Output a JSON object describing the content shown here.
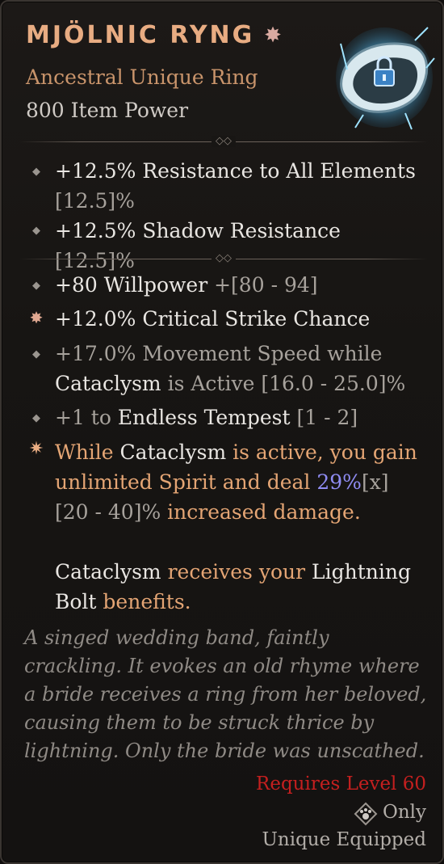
{
  "item": {
    "name": "MJÖLNIC RYNG",
    "name_icon": "sparkle-icon",
    "rarity_line": "Ancestral Unique Ring",
    "item_power": "800 Item Power",
    "image": "lightning-ring-image",
    "lock_icon": "padlock-icon"
  },
  "implicits": [
    {
      "text": "+12.5% Resistance to All Elements",
      "range": "[12.5]%"
    },
    {
      "text": "+12.5% Shadow Resistance",
      "range": "[12.5]%"
    }
  ],
  "affixes": {
    "willpower": {
      "text": "+80 Willpower",
      "range": "+[80 - 94]"
    },
    "crit": {
      "text": "+12.0% Critical Strike Chance"
    },
    "movement": {
      "part1": "+17.0% Movement Speed while",
      "skill": "Cataclysm",
      "part2": " is Active",
      "range": " [16.0 - 25.0]%"
    },
    "tempest": {
      "prefix": "+1 to ",
      "skill": "Endless Tempest",
      "range": " [1 - 2]"
    }
  },
  "unique_power": {
    "p1": "While ",
    "s1": "Cataclysm",
    "p2": " is active, you gain unlimited Spirit and deal ",
    "value": "29%",
    "mult": "[x]",
    "range": " [20 - 40]%",
    "p3": " increased damage.",
    "s2": "Cataclysm",
    "p4": " receives your ",
    "s3": "Lightning Bolt",
    "p5": " benefits."
  },
  "flavor": "A singed wedding band, faintly crackling. It evokes an old rhyme where a bride receives a ring from her beloved, causing them to be struck thrice by lightning. Only the bride was unscathed.",
  "footer": {
    "requirement": "Requires Level 60",
    "class_only": "Only",
    "class_icon": "druid-paw-icon",
    "unique_equipped": "Unique Equipped"
  },
  "colors": {
    "title": "#e8ac82",
    "legendary_text": "#e4a574",
    "requirement": "#c41f1f",
    "value_highlight": "#8f8cf2"
  }
}
